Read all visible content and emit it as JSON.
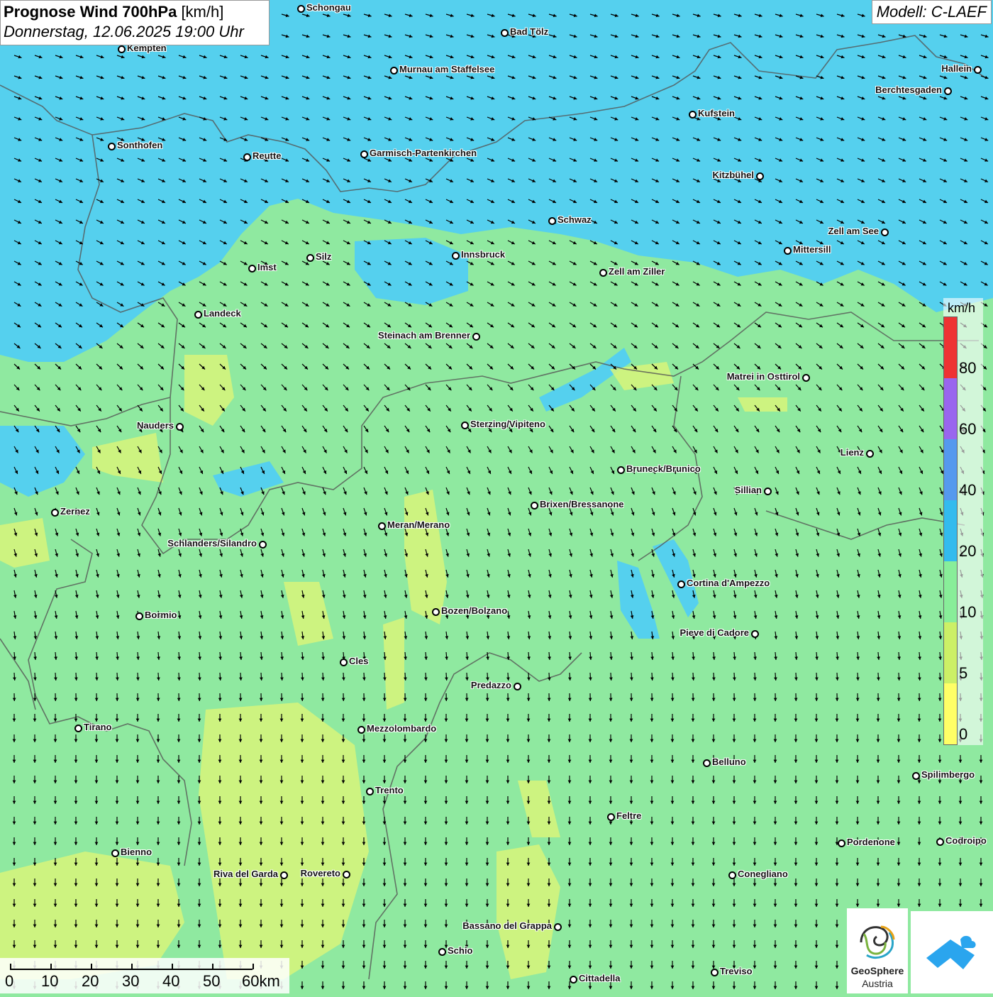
{
  "title": {
    "main_bold": "Prognose Wind 700hPa",
    "main_unit": "[km/h]",
    "subtitle": "Donnerstag, 12.06.2025 19:00 Uhr"
  },
  "model_label": "Modell: C-LAEF",
  "legend": {
    "unit": "km/h",
    "ticks": [
      "80",
      "60",
      "40",
      "20",
      "10",
      "5",
      "0"
    ],
    "colors": [
      "#ee3333",
      "#9966ee",
      "#5599ee",
      "#33bbee",
      "#88ee99",
      "#ccf066",
      "#ffff66"
    ]
  },
  "scale_bar": {
    "labels": [
      "0",
      "10",
      "20",
      "30",
      "40",
      "50",
      "60km"
    ]
  },
  "colors": {
    "wind_strong_blue": "#55d0ee",
    "wind_green": "#8fe9a0",
    "wind_yellow": "#d8f47a",
    "border": "#555555"
  },
  "logos": {
    "geosphere_line1": "GeoSphere",
    "geosphere_line2": "Austria"
  },
  "cities": [
    {
      "name": "Schongau"
    },
    {
      "name": "Bad Tölz"
    },
    {
      "name": "Kempten"
    },
    {
      "name": "Murnau am Staffelsee"
    },
    {
      "name": "Hallein"
    },
    {
      "name": "Berchtesgaden"
    },
    {
      "name": "Kufstein"
    },
    {
      "name": "Sonthofen"
    },
    {
      "name": "Reutte"
    },
    {
      "name": "Garmisch-Partenkirchen"
    },
    {
      "name": "Kitzbühel"
    },
    {
      "name": "Schwaz"
    },
    {
      "name": "Zell am See"
    },
    {
      "name": "Innsbruck"
    },
    {
      "name": "Mittersill"
    },
    {
      "name": "Silz"
    },
    {
      "name": "Imst"
    },
    {
      "name": "Zell am Ziller"
    },
    {
      "name": "Landeck"
    },
    {
      "name": "Steinach am Brenner"
    },
    {
      "name": "Matrei in Osttirol"
    },
    {
      "name": "Nauders"
    },
    {
      "name": "Sterzing/Vipiteno"
    },
    {
      "name": "Lienz"
    },
    {
      "name": "Bruneck/Brunico"
    },
    {
      "name": "Sillian"
    },
    {
      "name": "Brixen/Bressanone"
    },
    {
      "name": "Zernez"
    },
    {
      "name": "Meran/Merano"
    },
    {
      "name": "Schlanders/Silandro"
    },
    {
      "name": "Cortina d'Ampezzo"
    },
    {
      "name": "Bozen/Bolzano"
    },
    {
      "name": "Bormio"
    },
    {
      "name": "Pieve di Cadore"
    },
    {
      "name": "Cles"
    },
    {
      "name": "Predazzo"
    },
    {
      "name": "Tirano"
    },
    {
      "name": "Mezzolombardo"
    },
    {
      "name": "Belluno"
    },
    {
      "name": "Spilimbergo"
    },
    {
      "name": "Trento"
    },
    {
      "name": "Feltre"
    },
    {
      "name": "Pordenone"
    },
    {
      "name": "Codroipo"
    },
    {
      "name": "Bienno"
    },
    {
      "name": "Riva del Garda"
    },
    {
      "name": "Rovereto"
    },
    {
      "name": "Conegliano"
    },
    {
      "name": "Bassano del Grappa"
    },
    {
      "name": "Schio"
    },
    {
      "name": "Treviso"
    },
    {
      "name": "Cittadella"
    }
  ]
}
